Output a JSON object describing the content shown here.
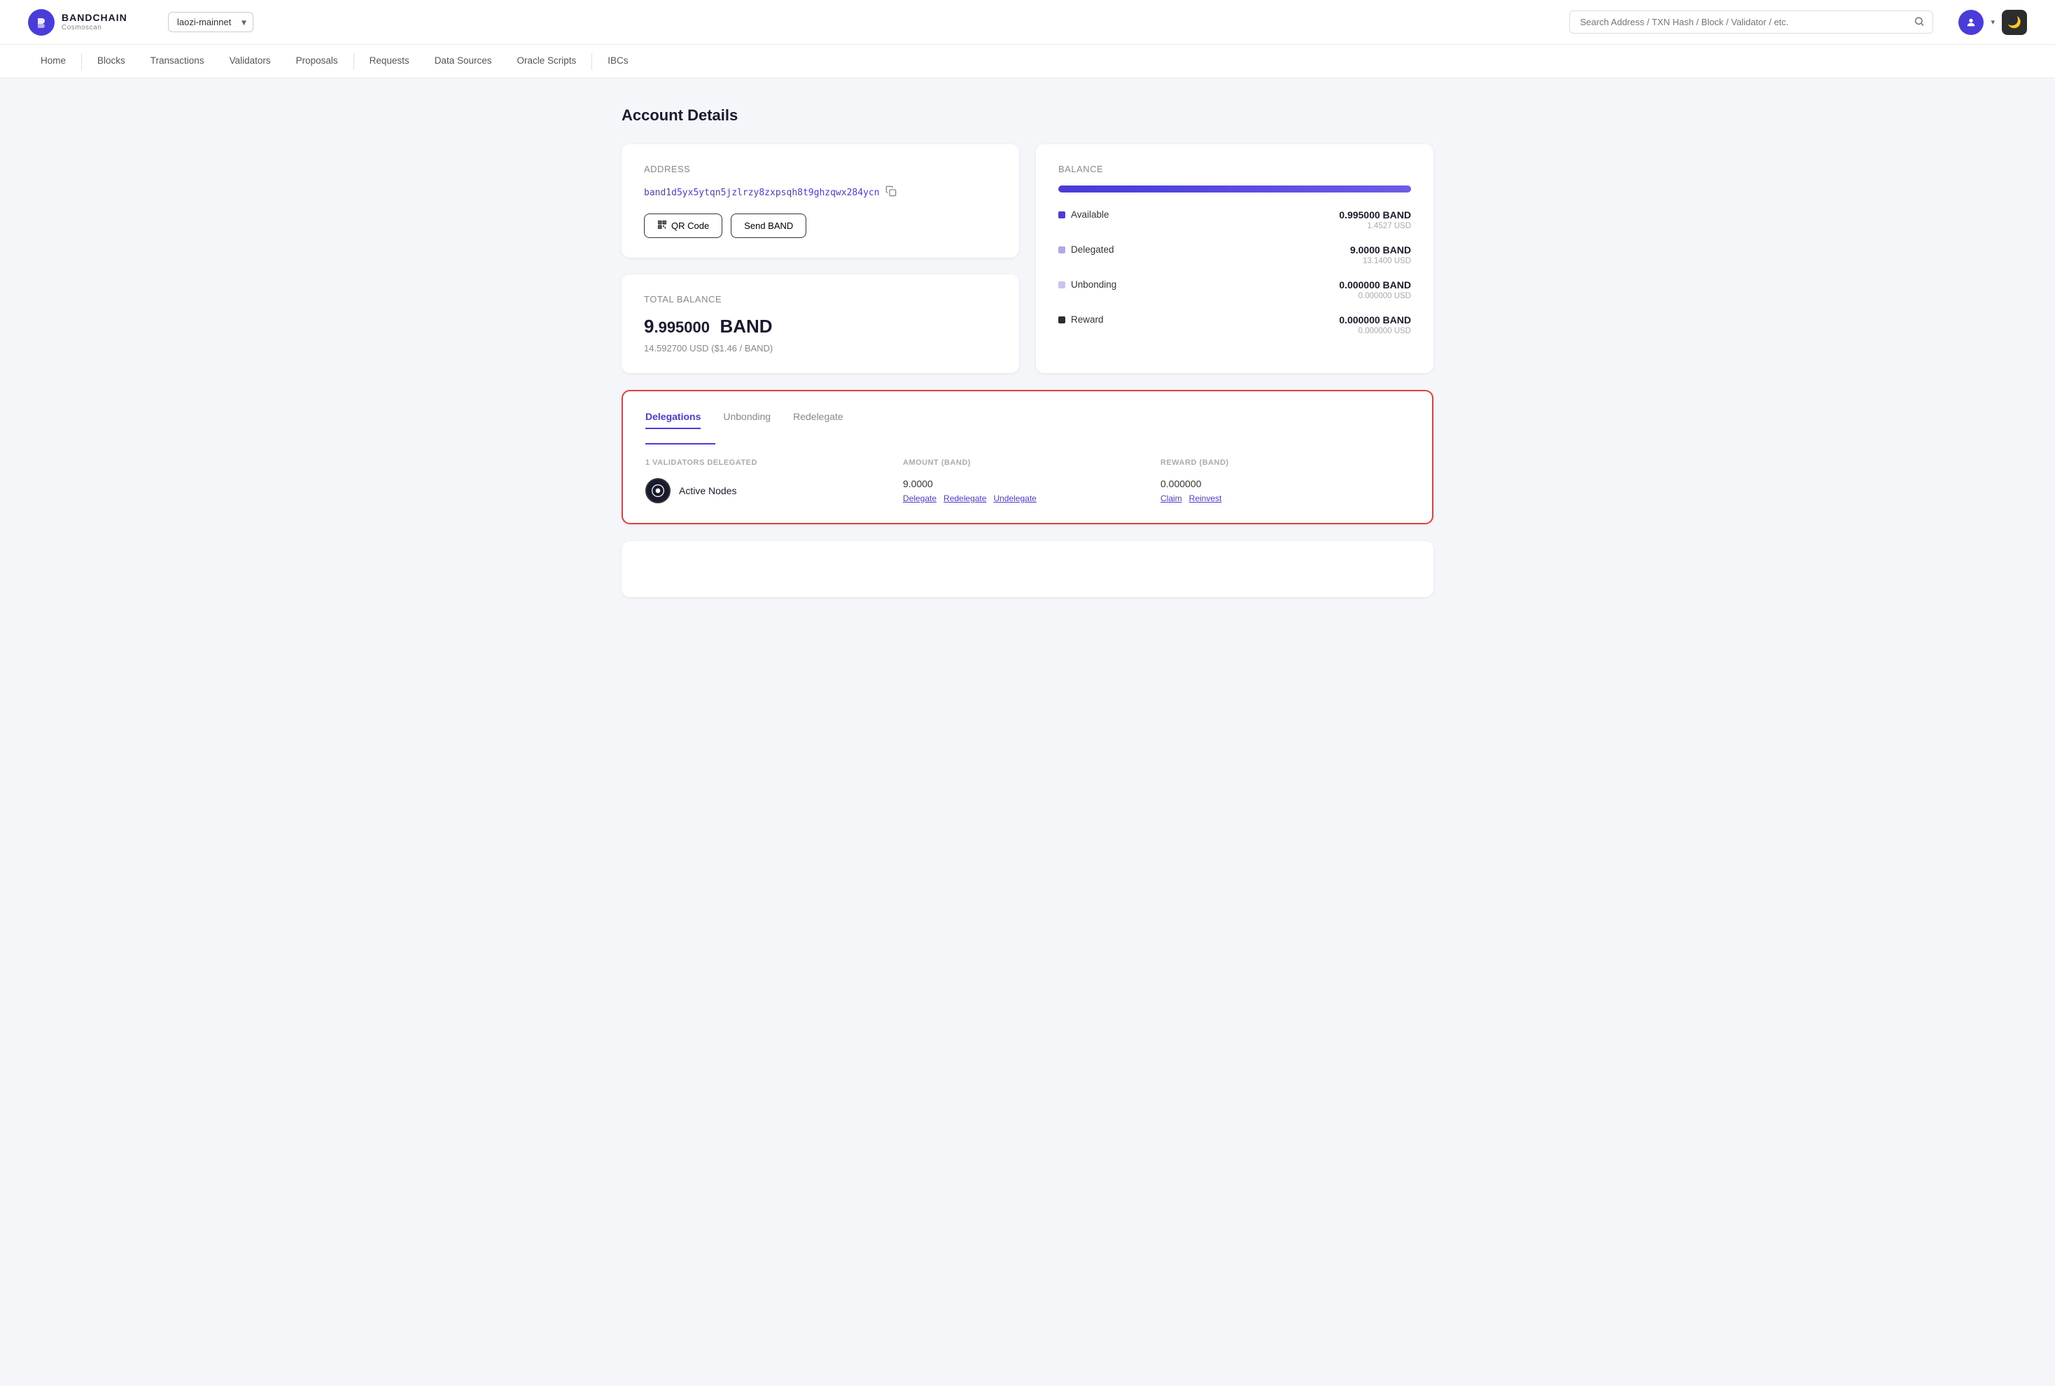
{
  "header": {
    "logo_letter": "B",
    "brand_name": "BANDCHAIN",
    "brand_sub": "Cosmoscan",
    "network_value": "laozi-mainnet",
    "search_placeholder": "Search Address / TXN Hash / Block / Validator / etc."
  },
  "nav": {
    "items": [
      {
        "label": "Home",
        "active": false
      },
      {
        "label": "Blocks",
        "active": false
      },
      {
        "label": "Transactions",
        "active": false
      },
      {
        "label": "Validators",
        "active": false
      },
      {
        "label": "Proposals",
        "active": false
      },
      {
        "label": "Requests",
        "active": false
      },
      {
        "label": "Data Sources",
        "active": false
      },
      {
        "label": "Oracle Scripts",
        "active": false
      },
      {
        "label": "IBCs",
        "active": false
      }
    ]
  },
  "page": {
    "title": "Account Details"
  },
  "address_card": {
    "label": "Address",
    "value": "band1d5yx5ytqn5jzlrzy8zxpsqh8t9ghzqwx284ycn",
    "qr_button": "QR Code",
    "send_button": "Send BAND"
  },
  "total_balance_card": {
    "label": "Total Balance",
    "amount_whole": "9",
    "amount_decimal": ".995000",
    "amount_unit": "BAND",
    "usd_value": "14.592700 USD ($1.46 / BAND)"
  },
  "balance_card": {
    "title": "Balance",
    "rows": [
      {
        "label": "Available",
        "dot_class": "dot-available",
        "band_value": "0.995000 BAND",
        "usd_value": "1.4527 USD"
      },
      {
        "label": "Delegated",
        "dot_class": "dot-delegated",
        "band_value": "9.0000 BAND",
        "usd_value": "13.1400 USD"
      },
      {
        "label": "Unbonding",
        "dot_class": "dot-unbonding",
        "band_value": "0.000000 BAND",
        "usd_value": "0.000000 USD"
      },
      {
        "label": "Reward",
        "dot_class": "dot-reward",
        "band_value": "0.000000 BAND",
        "usd_value": "0.000000 USD"
      }
    ]
  },
  "delegations": {
    "tabs": [
      {
        "label": "Delegations",
        "active": true
      },
      {
        "label": "Unbonding",
        "active": false
      },
      {
        "label": "Redelegate",
        "active": false
      }
    ],
    "header_validators": "1 VALIDATORS DELEGATED",
    "header_amount": "AMOUNT (BAND)",
    "header_reward": "REWARD (BAND)",
    "row": {
      "validator_name": "Active Nodes",
      "amount": "9.0000",
      "delegate_link": "Delegate",
      "redelegate_link": "Redelegate",
      "undelegate_link": "Undelegate",
      "reward": "0.000000",
      "claim_link": "Claim",
      "reinvest_link": "Reinvest"
    }
  }
}
